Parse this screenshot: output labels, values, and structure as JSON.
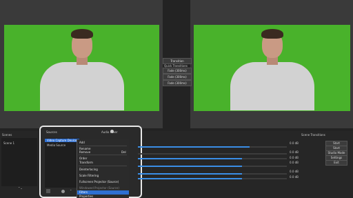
{
  "transition": {
    "label": "Transition",
    "quick_label": "Quick Transitions",
    "buttons": [
      "Fade (300ms)",
      "Fade (300ms)",
      "Fade (300ms)"
    ]
  },
  "scenes": {
    "header": "Scenes",
    "items": [
      "Scene 1"
    ]
  },
  "sources": {
    "header": "Sources",
    "items": [
      "Video Capture Device",
      "Media Source"
    ]
  },
  "mixer": {
    "header": "Audio Mixer",
    "rows": [
      {
        "label": "0.0 dB",
        "level": 0.75
      },
      {
        "label": "0.0 dB",
        "level": 0.0
      },
      {
        "label": "0.0 dB",
        "level": 0.7
      },
      {
        "label": "0.0 dB",
        "level": 0.7
      },
      {
        "label": "0.0 dB",
        "level": 0.7
      },
      {
        "label": "0.0 dB",
        "level": 0.7
      }
    ]
  },
  "controls": {
    "header": "Scene Transitions",
    "buttons": [
      "Start Streaming",
      "Start Recording",
      "Studio Mode",
      "Settings",
      "Exit"
    ]
  },
  "context_menu": {
    "items": [
      "Add",
      "Rename",
      "Remove",
      "Order",
      "Transform",
      "Deinterlacing",
      "Scale Filtering",
      "Fullscreen Projector (Source)",
      "Windowed Projector (Source)",
      "Filters",
      "Properties"
    ],
    "remove_shortcut": "Del"
  },
  "colors": {
    "accent": "#3a8ee6",
    "chroma_green": "#49b22b",
    "panel": "#262626",
    "highlight": "#2f6fd1"
  }
}
